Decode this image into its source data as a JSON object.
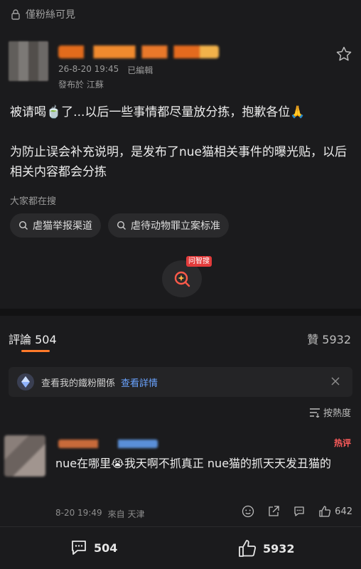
{
  "top": {
    "visibility": "僅粉絲可見"
  },
  "post": {
    "date": "26-8-20 19:45",
    "edited": "已編輯",
    "location": "發布於 江蘇",
    "paragraph1": "被请喝🍵了...以后一些事情都尽量放分拣，抱歉各位🙏",
    "paragraph2": "为防止误会补充说明，是发布了nue猫相关事件的曝光贴，以后相关内容都会分拣"
  },
  "search": {
    "label": "大家都在搜",
    "chips": [
      "虐猫举报渠道",
      "虐待动物罪立案标准"
    ],
    "ai_badge": "问智搜"
  },
  "tabs": {
    "comments": "評論 504",
    "likes": "贊 5932"
  },
  "fan_banner": {
    "text": "查看我的鐵粉關係",
    "link": "查看詳情"
  },
  "sort": {
    "label": "按熱度"
  },
  "comment": {
    "hot": "热评",
    "text": "nue在哪里😭我天啊不抓真正 nue猫的抓天天发丑猫的",
    "time": "8-20 19:49",
    "from": "來自 天津",
    "likes": "642"
  },
  "bottom": {
    "comments": "504",
    "likes": "5932"
  },
  "colors": {
    "accent": "#ff7a2a",
    "link": "#6aa3ff",
    "hot": "#ff5c5c"
  }
}
